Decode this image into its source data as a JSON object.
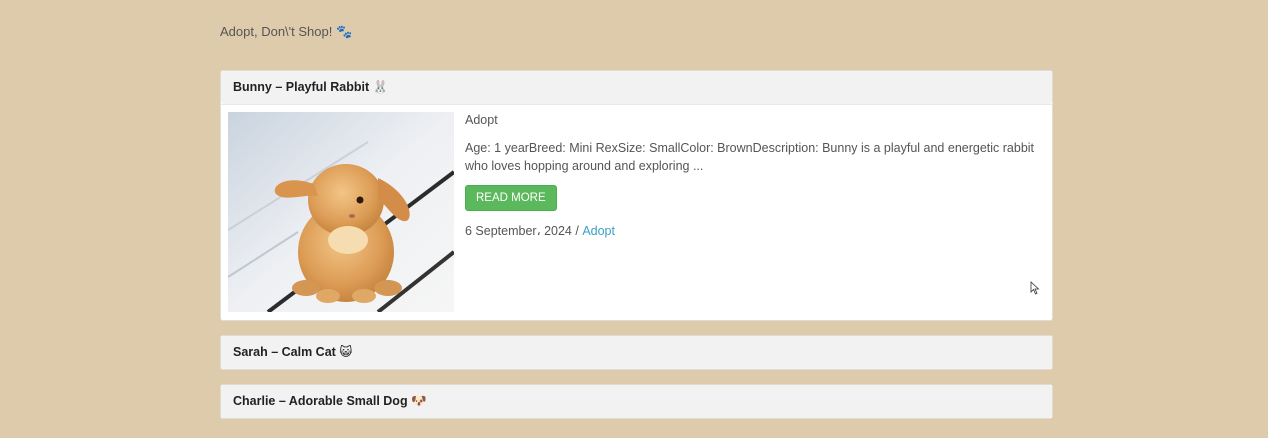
{
  "page": {
    "heading": "Adopt, Don\\'t Shop! 🐾"
  },
  "pets": [
    {
      "title": "Bunny – Playful Rabbit 🐰",
      "category": "Adopt",
      "description": "Age: 1 yearBreed: Mini RexSize: SmallColor: BrownDescription: Bunny is a playful and energetic rabbit who loves hopping around and exploring ...",
      "button_label": "READ MORE",
      "date": "6 September، 2024",
      "separator": " / ",
      "category_link": "Adopt"
    },
    {
      "title": "Sarah – Calm Cat 😺"
    },
    {
      "title": "Charlie – Adorable Small Dog 🐶"
    }
  ],
  "colors": {
    "background": "#decbac",
    "button": "#5cb85c",
    "link": "#3aa1c6"
  }
}
